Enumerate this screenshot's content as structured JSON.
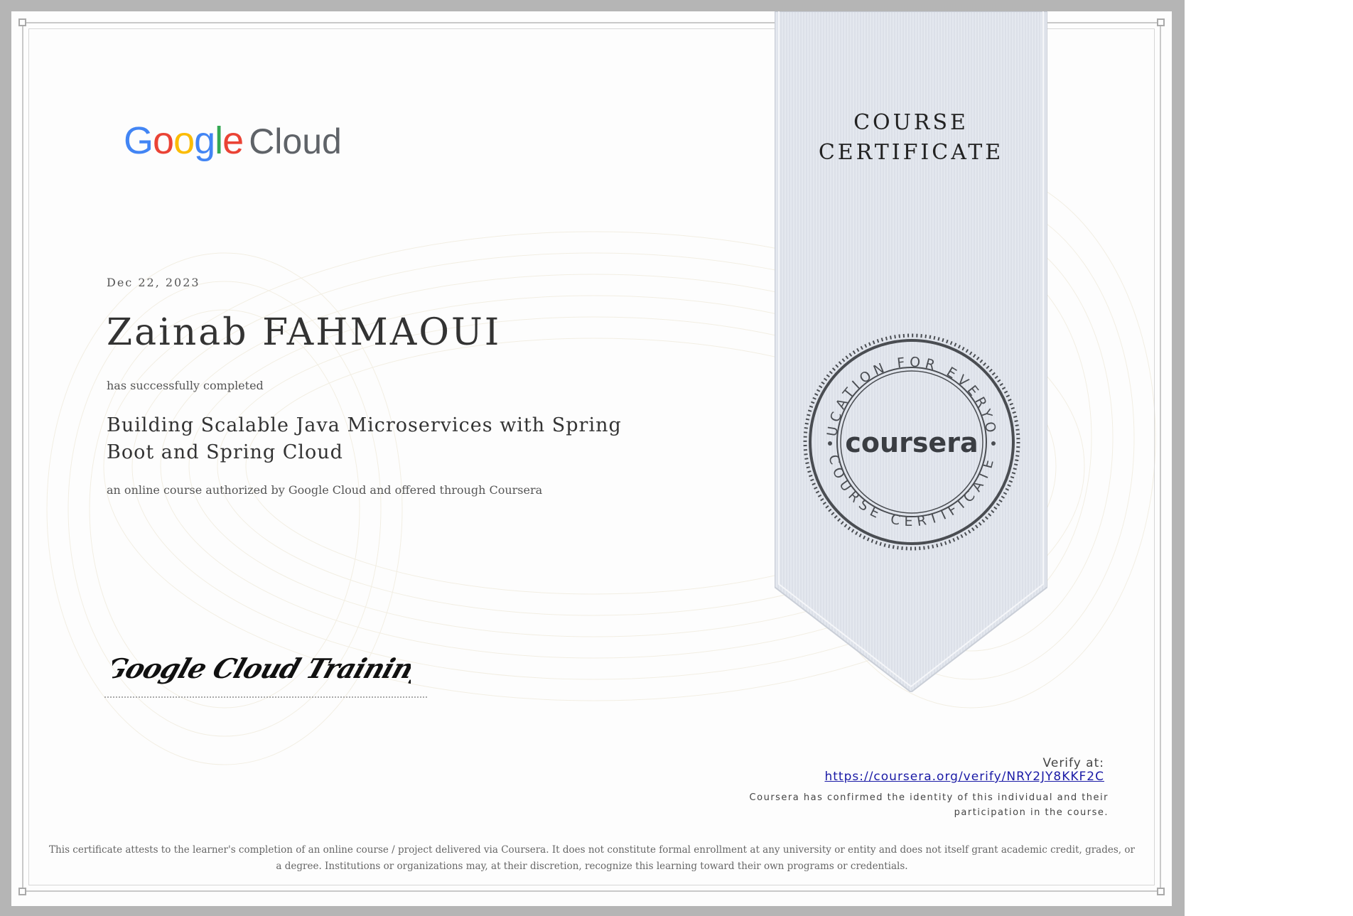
{
  "logo": {
    "brand": "Google",
    "product": "Cloud",
    "colors": [
      "#4285F4",
      "#EA4335",
      "#FBBC05",
      "#4285F4",
      "#34A853",
      "#EA4335"
    ]
  },
  "certificate": {
    "date": "Dec 22, 2023",
    "recipient": "Zainab FAHMAOUI",
    "completed_text": "has successfully completed",
    "course_title": "Building Scalable Java Microservices with Spring Boot and Spring Cloud",
    "authorized_text": "an online course authorized by Google Cloud and offered through Coursera",
    "signature": "Google Cloud Training"
  },
  "ribbon": {
    "title_line1": "COURSE",
    "title_line2": "CERTIFICATE",
    "seal_top_text": "EDUCATION FOR EVERYONE",
    "seal_center": "coursera",
    "seal_bottom_text": "COURSE CERTIFICATE"
  },
  "verify": {
    "label": "Verify at:",
    "url": "https://coursera.org/verify/NRY2JY8KKF2C",
    "confirmed_line1": "Coursera has confirmed the identity of this individual and their",
    "confirmed_line2": "participation in the course."
  },
  "disclaimer": {
    "line1": "This certificate attests to the learner's completion of an online course / project delivered via Coursera. It does not constitute formal enrollment at any university or entity and does not itself grant academic credit, grades, or",
    "line2": "a degree. Institutions or organizations may, at their discretion, recognize this learning toward their own programs or credentials."
  },
  "colors": {
    "ribbon_fill": "#e4e8ef",
    "seal_ink": "#4a4d52",
    "link": "#1a1aa6"
  }
}
